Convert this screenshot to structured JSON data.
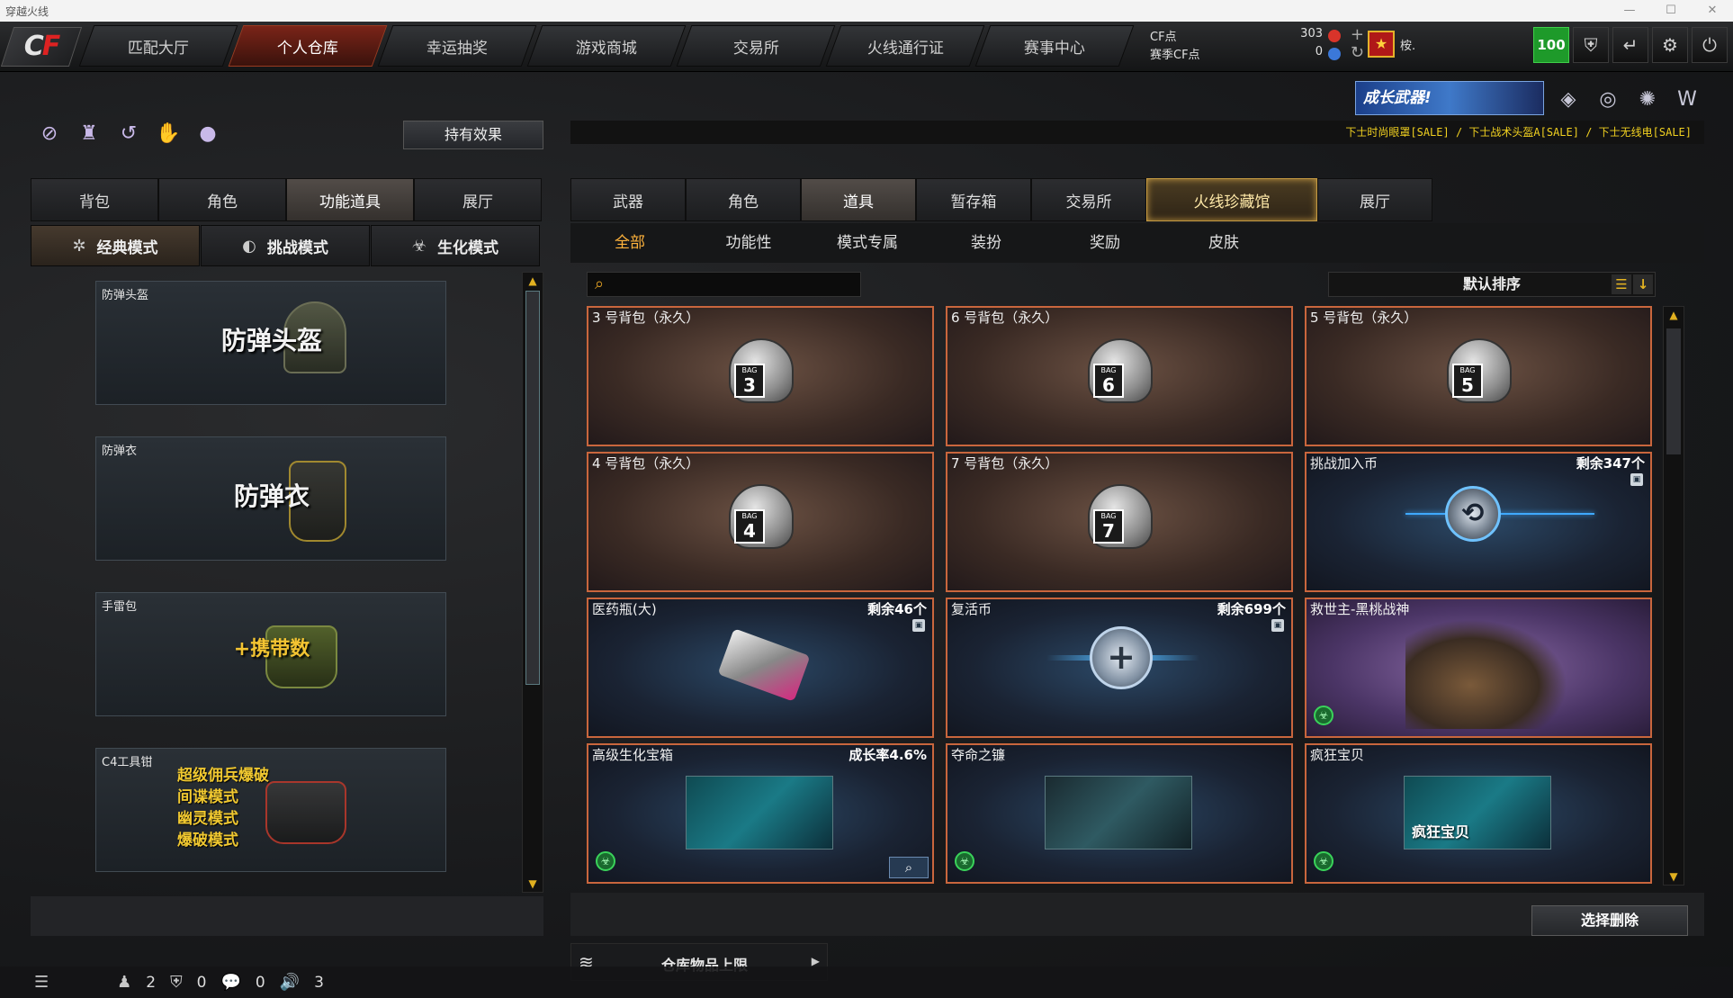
{
  "window": {
    "title": "穿越火线"
  },
  "nav": {
    "tabs": [
      {
        "label": "匹配大厅"
      },
      {
        "label": "个人仓库"
      },
      {
        "label": "幸运抽奖"
      },
      {
        "label": "游戏商城"
      },
      {
        "label": "交易所"
      },
      {
        "label": "火线通行证"
      },
      {
        "label": "赛事中心"
      }
    ]
  },
  "currency": {
    "cf_label": "CF点",
    "cf_value": "303",
    "season_label": "赛季CF点",
    "season_value": "0"
  },
  "player": {
    "rank_icon": "rank-star-icon",
    "name": "桉.",
    "level": "100"
  },
  "banner": {
    "text": "成长武器!"
  },
  "ticker": {
    "text": "下士时尚眼罩[SALE] / 下士战术头盔A[SALE] / 下士无线电[SALE]"
  },
  "left": {
    "effect_button": "持有效果",
    "tabs": [
      {
        "label": "背包"
      },
      {
        "label": "角色"
      },
      {
        "label": "功能道具"
      },
      {
        "label": "展厅"
      }
    ],
    "modes": [
      {
        "label": "经典模式",
        "icon": "star-icon"
      },
      {
        "label": "挑战模式",
        "icon": "pulse-icon"
      },
      {
        "label": "生化模式",
        "icon": "biohazard-icon"
      }
    ],
    "items": [
      {
        "title": "防弹头盔",
        "art_text": "防弹头盔"
      },
      {
        "title": "防弹衣",
        "art_text": "防弹衣"
      },
      {
        "title": "手雷包",
        "art_text": "+携带数"
      },
      {
        "title": "C4工具钳",
        "modes": [
          "超级佣兵爆破",
          "间谍模式",
          "幽灵模式",
          "爆破模式"
        ]
      }
    ]
  },
  "right": {
    "tabs": [
      {
        "label": "武器"
      },
      {
        "label": "角色"
      },
      {
        "label": "道具"
      },
      {
        "label": "暂存箱"
      },
      {
        "label": "交易所"
      },
      {
        "label": "火线珍藏馆"
      },
      {
        "label": "展厅"
      }
    ],
    "subfilters": [
      {
        "label": "全部"
      },
      {
        "label": "功能性"
      },
      {
        "label": "模式专属"
      },
      {
        "label": "装扮"
      },
      {
        "label": "奖励"
      },
      {
        "label": "皮肤"
      }
    ],
    "search": {
      "placeholder": ""
    },
    "sort": {
      "label": "默认排序"
    },
    "items": [
      {
        "name": "3 号背包（永久）",
        "bag": "3"
      },
      {
        "name": "6 号背包（永久）",
        "bag": "6"
      },
      {
        "name": "5 号背包（永久）",
        "bag": "5"
      },
      {
        "name": "4 号背包（永久）",
        "bag": "4"
      },
      {
        "name": "7 号背包（永久）",
        "bag": "7"
      },
      {
        "name": "挑战加入币",
        "info": "剩余347个"
      },
      {
        "name": "医药瓶(大)",
        "info": "剩余46个"
      },
      {
        "name": "复活币",
        "info": "剩余699个"
      },
      {
        "name": "救世主-黑桃战神"
      },
      {
        "name": "高级生化宝箱",
        "info": "成长率4.6%"
      },
      {
        "name": "夺命之镰"
      },
      {
        "name": "疯狂宝贝",
        "thumb_text": "疯狂宝贝"
      }
    ],
    "delete_button": "选择删除",
    "capacity_label": "仓库物品上限"
  },
  "statusbar": {
    "items": [
      "2",
      "0",
      "0",
      "3"
    ]
  }
}
